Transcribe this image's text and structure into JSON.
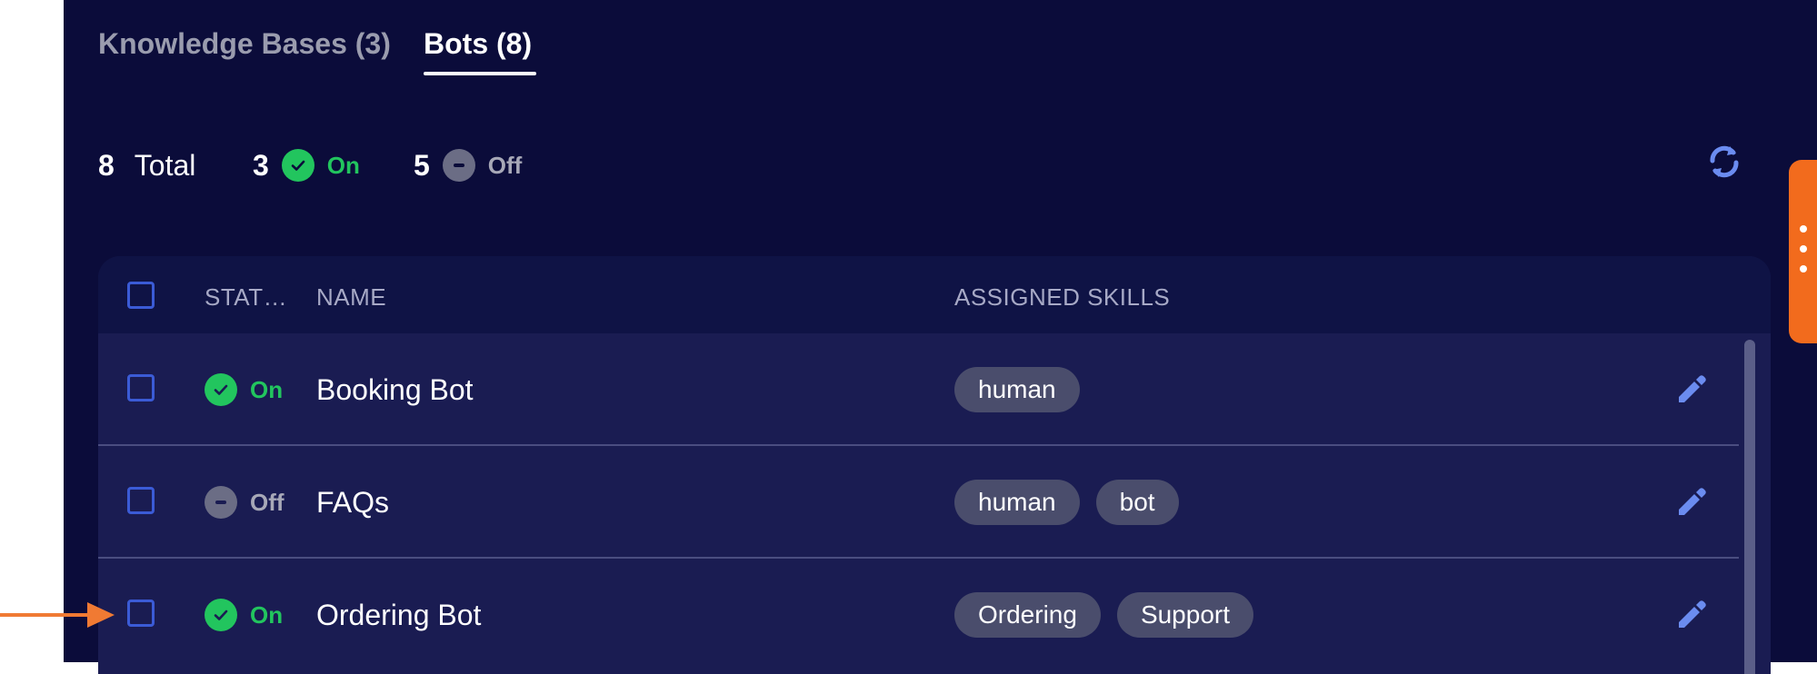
{
  "tabs": [
    {
      "label": "Knowledge Bases (3)",
      "active": false
    },
    {
      "label": "Bots (8)",
      "active": true
    }
  ],
  "summary": {
    "total_count": "8",
    "total_label": "Total",
    "on_count": "3",
    "on_label": "On",
    "off_count": "5",
    "off_label": "Off"
  },
  "table": {
    "headers": {
      "status": "STAT…",
      "name": "NAME",
      "skills": "ASSIGNED SKILLS"
    },
    "rows": [
      {
        "status": "On",
        "status_type": "on",
        "name": "Booking Bot",
        "skills": [
          "human"
        ]
      },
      {
        "status": "Off",
        "status_type": "off",
        "name": "FAQs",
        "skills": [
          "human",
          "bot"
        ]
      },
      {
        "status": "On",
        "status_type": "on",
        "name": "Ordering Bot",
        "skills": [
          "Ordering",
          "Support"
        ]
      }
    ]
  },
  "icons": {
    "refresh": "refresh-icon",
    "edit": "pencil-icon",
    "on": "check-circle-icon",
    "off": "minus-circle-icon",
    "arrow": "arrow-right-icon"
  },
  "colors": {
    "background": "#0b0c3a",
    "on": "#22c55e",
    "off": "#6b6d85",
    "accent": "#3b5bd6",
    "handle": "#f26b1d"
  }
}
